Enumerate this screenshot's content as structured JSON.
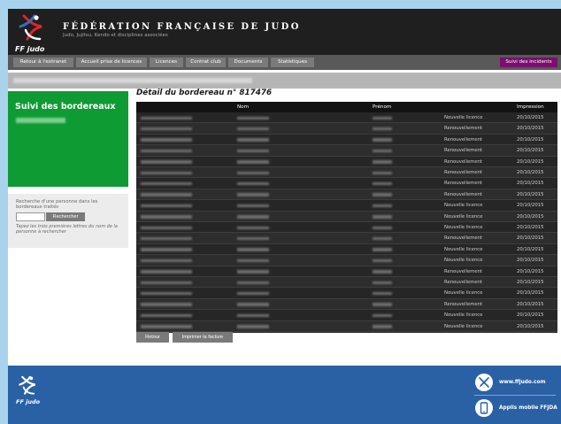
{
  "header": {
    "logo_text": "FF judo",
    "title": "FÉDÉRATION FRANÇAISE DE JUDO",
    "subtitle": "Judo, Jujitsu, Kendo et disciplines associées"
  },
  "menu": [
    {
      "label": "Retour à l'extranet"
    },
    {
      "label": "Accueil prise de licences"
    },
    {
      "label": "Licences"
    },
    {
      "label": "Contrat club"
    },
    {
      "label": "Documents"
    },
    {
      "label": "Statistiques"
    }
  ],
  "menu_right": {
    "label": "Suivi des incidents"
  },
  "sidebar": {
    "title": "Suivi des bordereaux",
    "search_label": "Recherche d'une personne dans les bordereaux traités",
    "search_button": "Rechercher",
    "search_hint": "Tapez les trois premières lettres du nom de la personne à rechercher"
  },
  "main": {
    "title": "Détail du bordereau n° 817476",
    "columns": [
      "",
      "Nom",
      "Prénom",
      "",
      "Impression"
    ],
    "rows": [
      {
        "type": "Nouvelle licence",
        "date": "20/10/2015"
      },
      {
        "type": "Renouvellement",
        "date": "20/10/2015"
      },
      {
        "type": "Renouvellement",
        "date": "20/10/2015"
      },
      {
        "type": "Renouvellement",
        "date": "20/10/2015"
      },
      {
        "type": "Renouvellement",
        "date": "20/10/2015"
      },
      {
        "type": "Renouvellement",
        "date": "20/10/2015"
      },
      {
        "type": "Renouvellement",
        "date": "20/10/2015"
      },
      {
        "type": "Renouvellement",
        "date": "20/10/2015"
      },
      {
        "type": "Nouvelle licence",
        "date": "20/10/2015"
      },
      {
        "type": "Nouvelle licence",
        "date": "20/10/2015"
      },
      {
        "type": "Nouvelle licence",
        "date": "20/10/2015"
      },
      {
        "type": "Renouvellement",
        "date": "20/10/2015"
      },
      {
        "type": "Nouvelle licence",
        "date": "20/10/2015"
      },
      {
        "type": "Nouvelle licence",
        "date": "20/10/2015"
      },
      {
        "type": "Renouvellement",
        "date": "20/10/2015"
      },
      {
        "type": "Renouvellement",
        "date": "20/10/2015"
      },
      {
        "type": "Nouvelle licence",
        "date": "20/10/2015"
      },
      {
        "type": "Renouvellement",
        "date": "20/10/2015"
      },
      {
        "type": "Nouvelle licence",
        "date": "20/10/2015"
      },
      {
        "type": "Nouvelle licence",
        "date": "20/10/2015"
      }
    ],
    "buttons": {
      "back": "Retour",
      "print": "Imprimer la facture"
    }
  },
  "footer": {
    "logo_text": "FF judo",
    "site": "www.ffjudo.com",
    "app": "Applis mobile FFJDA"
  },
  "colors": {
    "header_bg": "#1f1f1f",
    "menu_bg": "#595959",
    "incidents": "#7b0f6f",
    "sidebar_green": "#0e9b34",
    "footer_blue": "#2a61a4",
    "page_bg": "#a9d3ec"
  },
  "icons": [
    "judo-logo-icon",
    "judo-footer-logo-icon",
    "judo-mobile-icon",
    "smartphone-icon"
  ]
}
